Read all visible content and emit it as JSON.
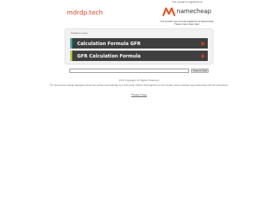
{
  "site": {
    "title": "mdrdp.tech"
  },
  "registrar": {
    "caption": "This domain is registered at",
    "brand": "namecheap",
    "note": "This domain was recently registered at Namecheap. Please check back later!"
  },
  "related": {
    "heading": "Related Links",
    "items": [
      {
        "label": "Calculation Formula GFR",
        "accent": "#3fa9a0"
      },
      {
        "label": "GFR Calculation Formula",
        "accent": "#b7c437"
      }
    ]
  },
  "search": {
    "value": "",
    "button_label": "Search Ads"
  },
  "footer": {
    "copyright": "2025 Copyright. All Rights Reserved.",
    "disclaimer": "The Sponsored Listings displayed above are served automatically by a third party. Neither Parkingcrew nor the domain owner maintain any relationship with the advertisers.",
    "privacy_label": "Privacy Policy"
  },
  "colors": {
    "brand_orange": "#d9421f",
    "link_bg": "#3f3f3f"
  },
  "icons": {
    "arrow": "arrow-right-icon",
    "logo": "namecheap-logo-icon"
  }
}
